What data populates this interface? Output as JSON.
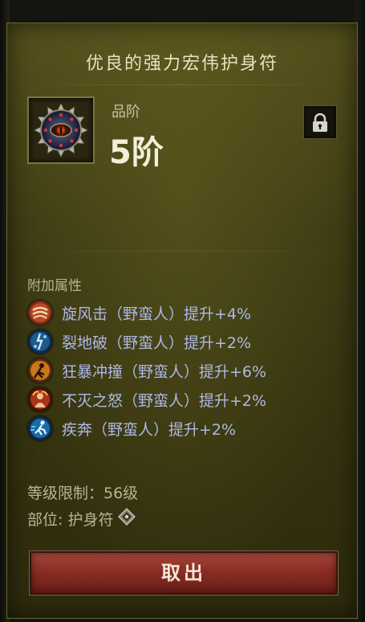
{
  "item": {
    "title": "优良的强力宏伟护身符",
    "grade_label": "品阶",
    "grade_value": "5阶",
    "icon": "amulet-icon",
    "lock_icon": "lock-icon"
  },
  "attributes": {
    "header": "附加属性",
    "affixes": [
      {
        "text": "旋风击（野蛮人）提升+4%",
        "icon": "whirlwind-skill-icon"
      },
      {
        "text": "裂地破（野蛮人）提升+2%",
        "icon": "seismic-slam-skill-icon"
      },
      {
        "text": "狂暴冲撞（野蛮人）提升+6%",
        "icon": "furious-charge-skill-icon"
      },
      {
        "text": "不灭之怒（野蛮人）提升+2%",
        "icon": "wrath-skill-icon"
      },
      {
        "text": "疾奔（野蛮人）提升+2%",
        "icon": "sprint-skill-icon"
      }
    ]
  },
  "requirements": {
    "level": "等级限制：56级",
    "slot": "部位: 护身符",
    "slot_icon": "slot-diamond-icon"
  },
  "actions": {
    "withdraw_label": "取出"
  },
  "colors": {
    "panel": "#3e3b14",
    "affix_text": "#aeb8e6",
    "label_text": "#b8b396",
    "button": "#8a2d24"
  }
}
